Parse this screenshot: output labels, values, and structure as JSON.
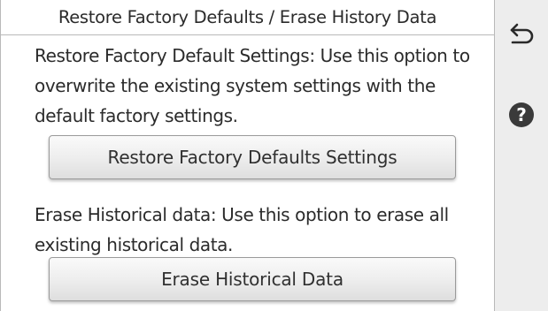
{
  "header": {
    "title": "Restore Factory Defaults / Erase History Data"
  },
  "restore": {
    "description": "Restore Factory Default Settings: Use this option to overwrite the existing system settings with the default factory settings.",
    "button_label": "Restore Factory Defaults Settings"
  },
  "erase": {
    "description": "Erase Historical data: Use this option to erase all existing historical data.",
    "button_label": "Erase Historical Data"
  },
  "sidebar": {
    "back_icon": "back-arrow-icon",
    "help_icon": "help-icon",
    "help_glyph": "?"
  },
  "colors": {
    "sidebar_bg": "#ededed",
    "help_circle": "#3a3a3a",
    "text": "#2b2b2b"
  }
}
